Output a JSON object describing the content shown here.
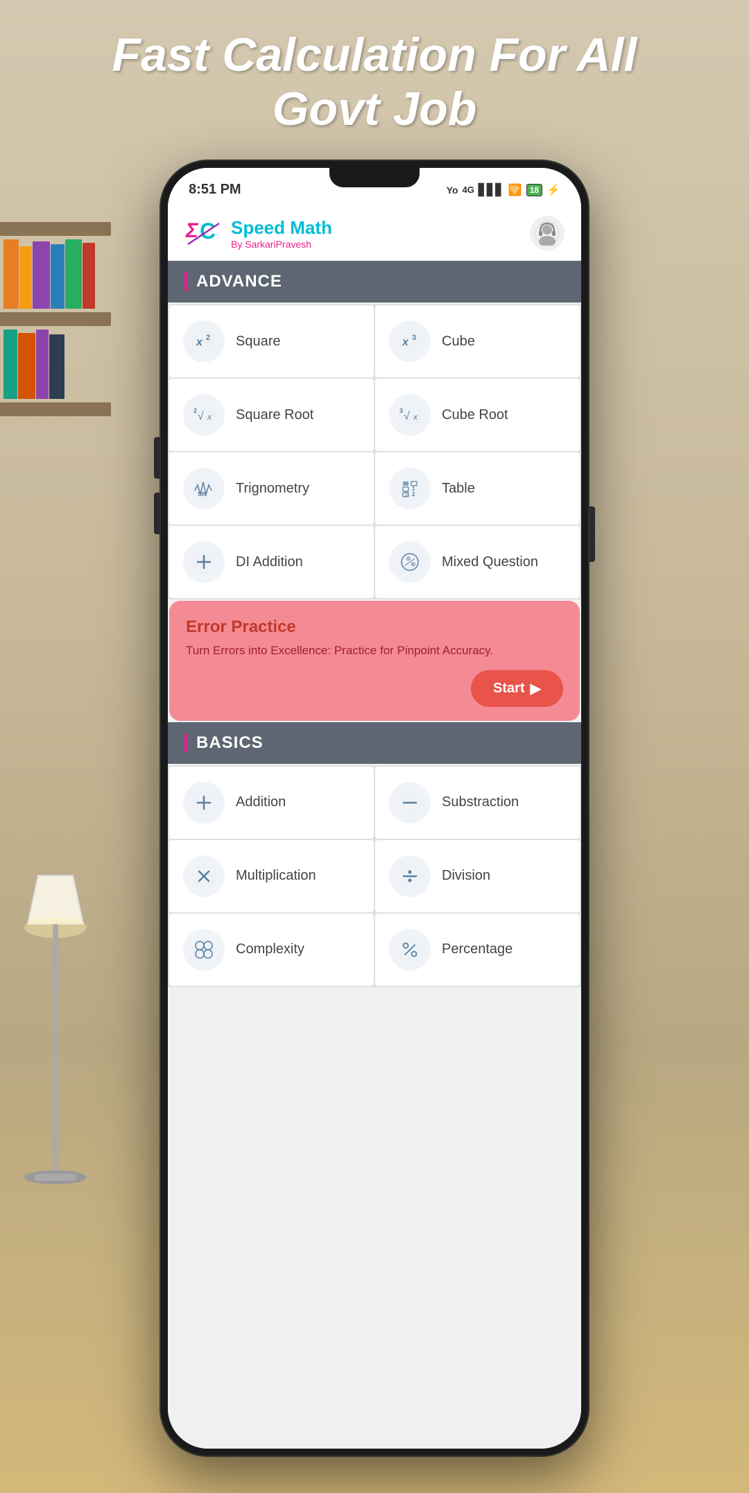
{
  "page": {
    "header_text_line1": "Fast Calculation For All",
    "header_text_line2": "Govt Job"
  },
  "status_bar": {
    "time": "8:51 PM",
    "network": "Yo 4G",
    "battery": "18"
  },
  "app_header": {
    "title": "Speed Math",
    "subtitle": "By SarkariPravesh"
  },
  "sections": [
    {
      "id": "advance",
      "title": "ADVANCE",
      "cards": [
        {
          "id": "square",
          "label": "Square",
          "icon": "x²"
        },
        {
          "id": "cube",
          "label": "Cube",
          "icon": "x³"
        },
        {
          "id": "square-root",
          "label": "Square Root",
          "icon": "²√x"
        },
        {
          "id": "cube-root",
          "label": "Cube Root",
          "icon": "³√x"
        },
        {
          "id": "trignometry",
          "label": "Trignometry",
          "icon": "sin"
        },
        {
          "id": "table",
          "label": "Table",
          "icon": "123"
        },
        {
          "id": "di-addition",
          "label": "DI Addition",
          "icon": "+"
        },
        {
          "id": "mixed-question",
          "label": "Mixed Question",
          "icon": "⊕"
        }
      ]
    },
    {
      "id": "basics",
      "title": "BASICS",
      "cards": [
        {
          "id": "addition",
          "label": "Addition",
          "icon": "+"
        },
        {
          "id": "substraction",
          "label": "Substraction",
          "icon": "−"
        },
        {
          "id": "multiplication",
          "label": "Multiplication",
          "icon": "×"
        },
        {
          "id": "division",
          "label": "Division",
          "icon": "÷"
        },
        {
          "id": "complexity",
          "label": "Complexity",
          "icon": "⊗"
        },
        {
          "id": "percentage",
          "label": "Percentage",
          "icon": "%"
        }
      ]
    }
  ],
  "error_practice": {
    "title": "Error Practice",
    "description": "Turn Errors into Excellence: Practice for Pinpoint Accuracy.",
    "start_label": "Start"
  }
}
